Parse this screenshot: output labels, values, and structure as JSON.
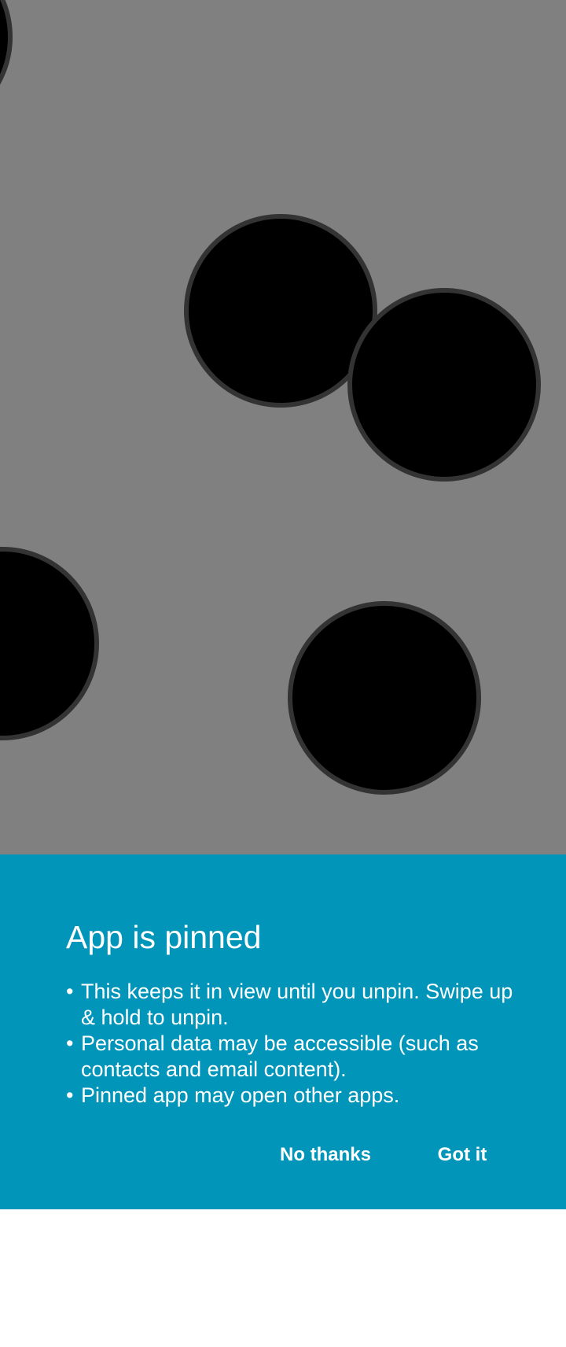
{
  "app_area": {
    "background_color": "#808080",
    "ball_fill": "#000000",
    "ball_stroke": "#333333"
  },
  "pin_dialog": {
    "background_color": "#0295ba",
    "title": "App is pinned",
    "bullet_glyph": "•",
    "bullets": [
      "This keeps it in view until you unpin. Swipe up & hold to unpin.",
      "Personal data may be accessible (such as contacts and email content).",
      "Pinned app may open other apps."
    ],
    "buttons": {
      "no_thanks": "No thanks",
      "got_it": "Got it"
    }
  }
}
